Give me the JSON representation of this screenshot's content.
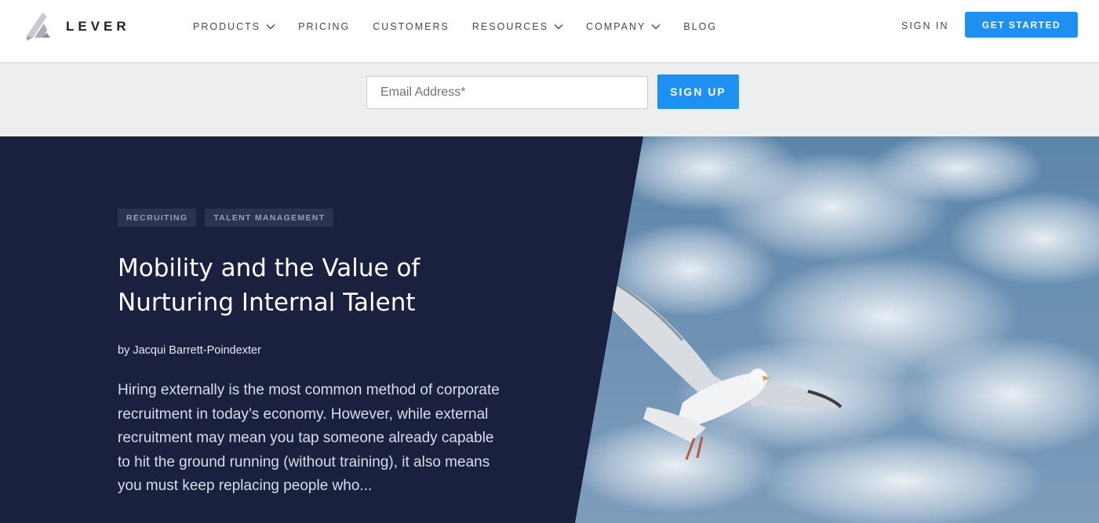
{
  "header": {
    "brand": "LEVER",
    "nav": [
      {
        "label": "PRODUCTS",
        "dropdown": true
      },
      {
        "label": "PRICING",
        "dropdown": false
      },
      {
        "label": "CUSTOMERS",
        "dropdown": false
      },
      {
        "label": "RESOURCES",
        "dropdown": true
      },
      {
        "label": "COMPANY",
        "dropdown": true
      },
      {
        "label": "BLOG",
        "dropdown": false
      }
    ],
    "sign_in": "SIGN IN",
    "get_started": "GET STARTED"
  },
  "signup": {
    "email_placeholder": "Email Address*",
    "email_value": "",
    "button": "SIGN UP"
  },
  "article": {
    "tags": [
      "RECRUITING",
      "TALENT MANAGEMENT"
    ],
    "title": "Mobility and the Value of Nurturing Internal Talent",
    "byline": "by Jacqui Barrett-Poindexter",
    "excerpt": "Hiring externally is the most common method of corporate recruitment in today’s economy. However, while external recruitment may mean you tap someone already capable to hit the ground running (without training), it also means you must keep replacing people who..."
  },
  "colors": {
    "accent": "#1d90f2",
    "hero_bg": "#19213f",
    "band_bg": "#eceef0",
    "sky": "#6e93b5"
  },
  "icons": [
    "lever-logo",
    "chevron-down-icon"
  ],
  "hero_image": "seagull-in-sky"
}
